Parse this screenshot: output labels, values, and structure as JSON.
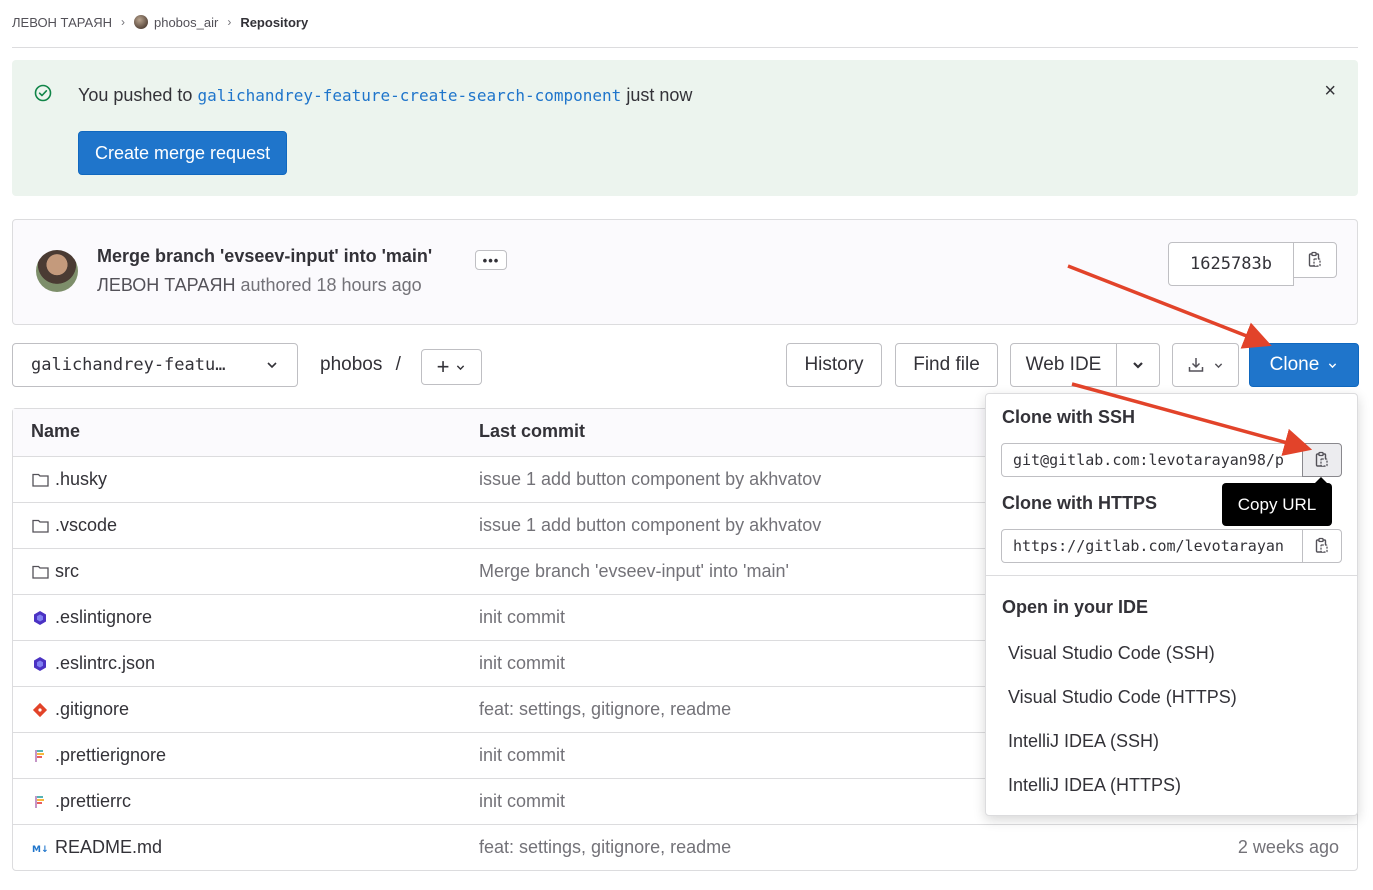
{
  "breadcrumb": {
    "owner": "ЛЕВОН ТАРАЯН",
    "project": "phobos_air",
    "current": "Repository"
  },
  "alert": {
    "prefix": "You pushed to",
    "branch": "galichandrey-feature-create-search-component",
    "suffix": "just now",
    "button_label": "Create merge request",
    "close_glyph": "×"
  },
  "commit": {
    "title": "Merge branch 'evseev-input' into 'main'",
    "ellipsis": "•••",
    "author": "ЛЕВОН ТАРАЯН",
    "authored": "authored 18 hours ago",
    "sha": "1625783b"
  },
  "toolbar": {
    "branch": "galichandrey-featu…",
    "path": "phobos",
    "path_sep": "/",
    "add_label": "+",
    "history": "History",
    "find_file": "Find file",
    "web_ide": "Web IDE",
    "clone": "Clone"
  },
  "table": {
    "headers": {
      "name": "Name",
      "last_commit": "Last commit"
    },
    "rows": [
      {
        "name": ".husky",
        "icon": "folder-icon",
        "commit": "issue 1 add button component by akhvatov",
        "date": ""
      },
      {
        "name": ".vscode",
        "icon": "folder-icon",
        "commit": "issue 1 add button component by akhvatov",
        "date": ""
      },
      {
        "name": "src",
        "icon": "folder-icon",
        "commit": "Merge branch 'evseev-input' into 'main'",
        "date": ""
      },
      {
        "name": ".eslintignore",
        "icon": "eslint-icon",
        "commit": "init commit",
        "date": ""
      },
      {
        "name": ".eslintrc.json",
        "icon": "eslint-icon",
        "commit": "init commit",
        "date": ""
      },
      {
        "name": ".gitignore",
        "icon": "git-icon",
        "commit": "feat: settings, gitignore, readme",
        "date": ""
      },
      {
        "name": ".prettierignore",
        "icon": "prettier-icon",
        "commit": "init commit",
        "date": ""
      },
      {
        "name": ".prettierrc",
        "icon": "prettier-icon",
        "commit": "init commit",
        "date": ""
      },
      {
        "name": "README.md",
        "icon": "markdown-icon",
        "commit": "feat: settings, gitignore, readme",
        "date": "2 weeks ago"
      }
    ]
  },
  "clone_dropdown": {
    "ssh_heading": "Clone with SSH",
    "ssh_url": "git@gitlab.com:levotarayan98/p",
    "https_heading": "Clone with HTTPS",
    "https_url": "https://gitlab.com/levotarayan",
    "ide_heading": "Open in your IDE",
    "ide_items": [
      "Visual Studio Code (SSH)",
      "Visual Studio Code (HTTPS)",
      "IntelliJ IDEA (SSH)",
      "IntelliJ IDEA (HTTPS)"
    ],
    "tooltip": "Copy URL"
  },
  "colors": {
    "primary": "#1f75cb",
    "success_bg": "#ecf4ee",
    "success_icon": "#108548",
    "annotation_arrow": "#e2432a"
  }
}
